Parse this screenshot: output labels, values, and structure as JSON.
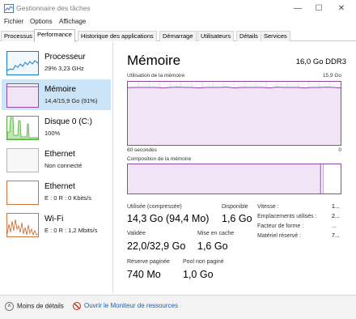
{
  "window": {
    "title": "Gestionnaire des tâches",
    "minimize_glyph": "—",
    "maximize_glyph": "☐",
    "close_glyph": "✕"
  },
  "menu": [
    "Fichier",
    "Options",
    "Affichage"
  ],
  "tabs": [
    "Processus",
    "Performance",
    "Historique des applications",
    "Démarrage",
    "Utilisateurs",
    "Détails",
    "Services"
  ],
  "active_tab": "Performance",
  "sidebar": {
    "items": [
      {
        "name": "Processeur",
        "sub": "29% 3,23 GHz",
        "color": "#1a7bc8"
      },
      {
        "name": "Mémoire",
        "sub": "14,4/15,9 Go (91%)",
        "color": "#8e4aa5"
      },
      {
        "name": "Disque 0 (C:)",
        "sub": "100%",
        "color": "#4caf37"
      },
      {
        "name": "Ethernet",
        "sub": "Non connecté",
        "color": "#a0a0a0"
      },
      {
        "name": "Ethernet",
        "sub": "E : 0 R : 0 Kbits/s",
        "color": "#c9753b"
      },
      {
        "name": "Wi-Fi",
        "sub": "E : 0 R : 1,2 Mbits/s",
        "color": "#c9753b"
      }
    ]
  },
  "main": {
    "title": "Mémoire",
    "spec": "16,0 Go DDR3",
    "usage_label": "Utilisation de la mémoire",
    "usage_max": "15,9 Go",
    "time_label": "60 secondes",
    "time_min": "0",
    "composition_label": "Composition de la mémoire",
    "usage_fraction": 0.91,
    "stats": {
      "in_use_label": "Utilisée (compressée)",
      "in_use_value": "14,3 Go (94,4 Mo)",
      "available_label": "Disponible",
      "available_value": "1,6 Go",
      "committed_label": "Validée",
      "committed_value": "22,0/32,9 Go",
      "cached_label": "Mise en cache",
      "cached_value": "1,6 Go",
      "paged_label": "Réserve paginée",
      "paged_value": "740 Mo",
      "nonpaged_label": "Pool non paginé",
      "nonpaged_value": "1,0 Go"
    },
    "details": [
      {
        "label": "Vitesse :",
        "value": "1..."
      },
      {
        "label": "Emplacements utilisés :",
        "value": "2..."
      },
      {
        "label": "Facteur de forme :",
        "value": "..."
      },
      {
        "label": "Matériel réservé :",
        "value": "7..."
      }
    ]
  },
  "footer": {
    "fewer_details": "Moins de détails",
    "open_resmon": "Ouvrir le Moniteur de ressources"
  },
  "colors": {
    "memory_accent": "#8e4aa5",
    "selected_bg": "#cce4f7"
  }
}
